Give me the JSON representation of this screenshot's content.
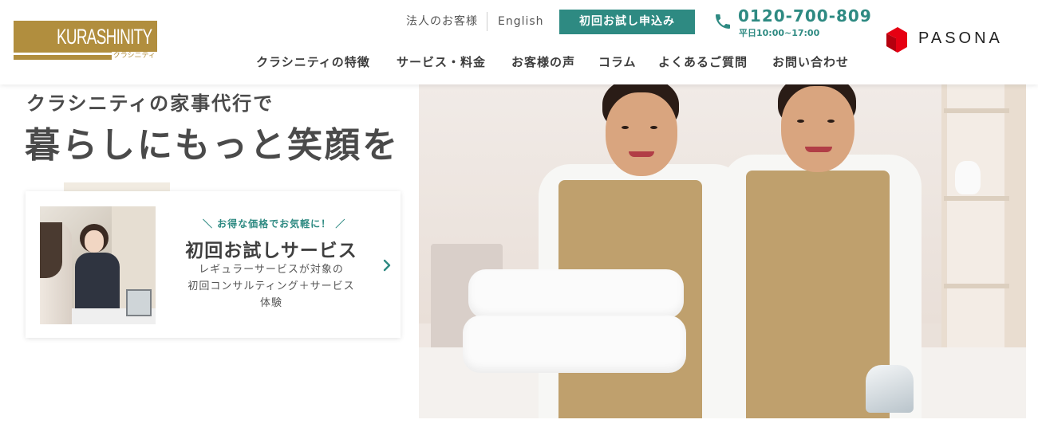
{
  "header": {
    "logo": {
      "text": "KURASHINITY",
      "kana": "クラシニティ"
    },
    "corporate_link": "法人のお客様",
    "english_link": "English",
    "trial_button": "初回お試し申込み",
    "phone": {
      "number": "0120-700-809",
      "hours": "平日10:00~17:00"
    },
    "partner_logo": "PASONA"
  },
  "nav": {
    "items": [
      {
        "label": "クラシニティの特徴"
      },
      {
        "label": "サービス・料金"
      },
      {
        "label": "お客様の声"
      },
      {
        "label": "コラム"
      },
      {
        "label": "よくあるご質問"
      },
      {
        "label": "お問い合わせ"
      }
    ]
  },
  "hero": {
    "subtitle": "クラシニティの家事代行で",
    "title": "暮らしにもっと笑顔を"
  },
  "trial_card": {
    "tag": "＼ お得な価格でお気軽に！ ／",
    "title": "初回お試しサービス",
    "desc_line1": "レギュラーサービスが対象の",
    "desc_line2": "初回コンサルティング＋サービス",
    "desc_line3": "体験"
  },
  "colors": {
    "brand_gold": "#b18e3e",
    "accent_teal": "#2e8a82",
    "pasona_red": "#e60012"
  },
  "icons": {
    "phone": "phone-icon",
    "arrow": "chevron-right-icon"
  }
}
